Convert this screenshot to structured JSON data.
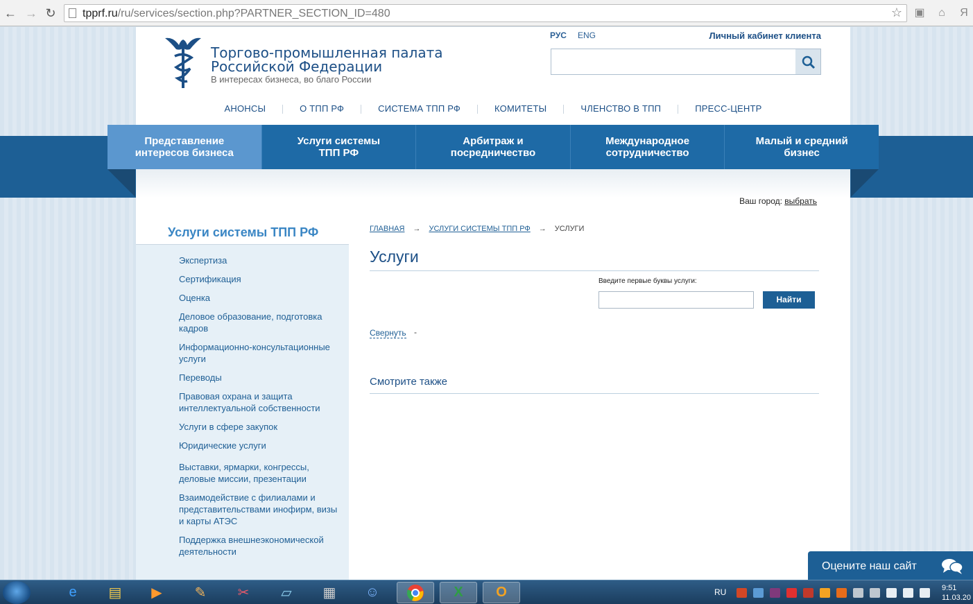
{
  "browser": {
    "url_host": "tpprf.ru",
    "url_path": "/ru/services/section.php?PARTNER_SECTION_ID=480",
    "ext_label": "Я"
  },
  "header": {
    "title_line1": "Торгово-промышленная палата",
    "title_line2": "Российской Федерации",
    "subtitle": "В интересах бизнеса, во благо России",
    "lang_ru": "РУС",
    "lang_en": "ENG",
    "cabinet": "Личный кабинет клиента"
  },
  "topnav": [
    "АНОНСЫ",
    "О ТПП РФ",
    "СИСТЕМА ТПП РФ",
    "КОМИТЕТЫ",
    "ЧЛЕНСТВО В ТПП",
    "ПРЕСС-ЦЕНТР"
  ],
  "mainnav": [
    {
      "l1": "Представление",
      "l2": "интересов бизнеса"
    },
    {
      "l1": "Услуги системы",
      "l2": "ТПП РФ"
    },
    {
      "l1": "Арбитраж и",
      "l2": "посредничество"
    },
    {
      "l1": "Международное",
      "l2": "сотрудничество"
    },
    {
      "l1": "Малый и средний",
      "l2": "бизнес"
    }
  ],
  "city": {
    "label": "Ваш город: ",
    "link": "выбрать"
  },
  "sidebar": {
    "title": "Услуги системы ТПП РФ",
    "items": [
      "Экспертиза",
      "Сертификация",
      "Оценка",
      "Деловое образование, подготовка кадров",
      "Информационно-консультационные услуги",
      "Переводы",
      "Правовая охрана и защита интеллектуальной собственности",
      "Услуги в сфере закупок",
      "Юридические услуги",
      "Выставки, ярмарки, конгрессы, деловые миссии, презентации",
      "Взаимодействие с филиалами и представительствами инофирм, визы и карты АТЭС",
      "Поддержка внешнеэкономической деятельности"
    ]
  },
  "breadcrumbs": {
    "home": "ГЛАВНАЯ",
    "section": "УСЛУГИ СИСТЕМЫ ТПП РФ",
    "current": "УСЛУГИ",
    "arrow": "→"
  },
  "content": {
    "title": "Услуги",
    "search_label": "Введите первые буквы услуги:",
    "search_value": "",
    "find_button": "Найти",
    "collapse_link": "Свернуть",
    "dash": "-",
    "see_also": "Смотрите также"
  },
  "rate_widget": {
    "label": "Оцените наш сайт"
  },
  "taskbar": {
    "lang": "RU",
    "time": "9:51",
    "date": "11.03.20"
  },
  "colors": {
    "brand": "#1d5f95",
    "nav_active": "#5b97cf",
    "link": "#1f5f95"
  }
}
